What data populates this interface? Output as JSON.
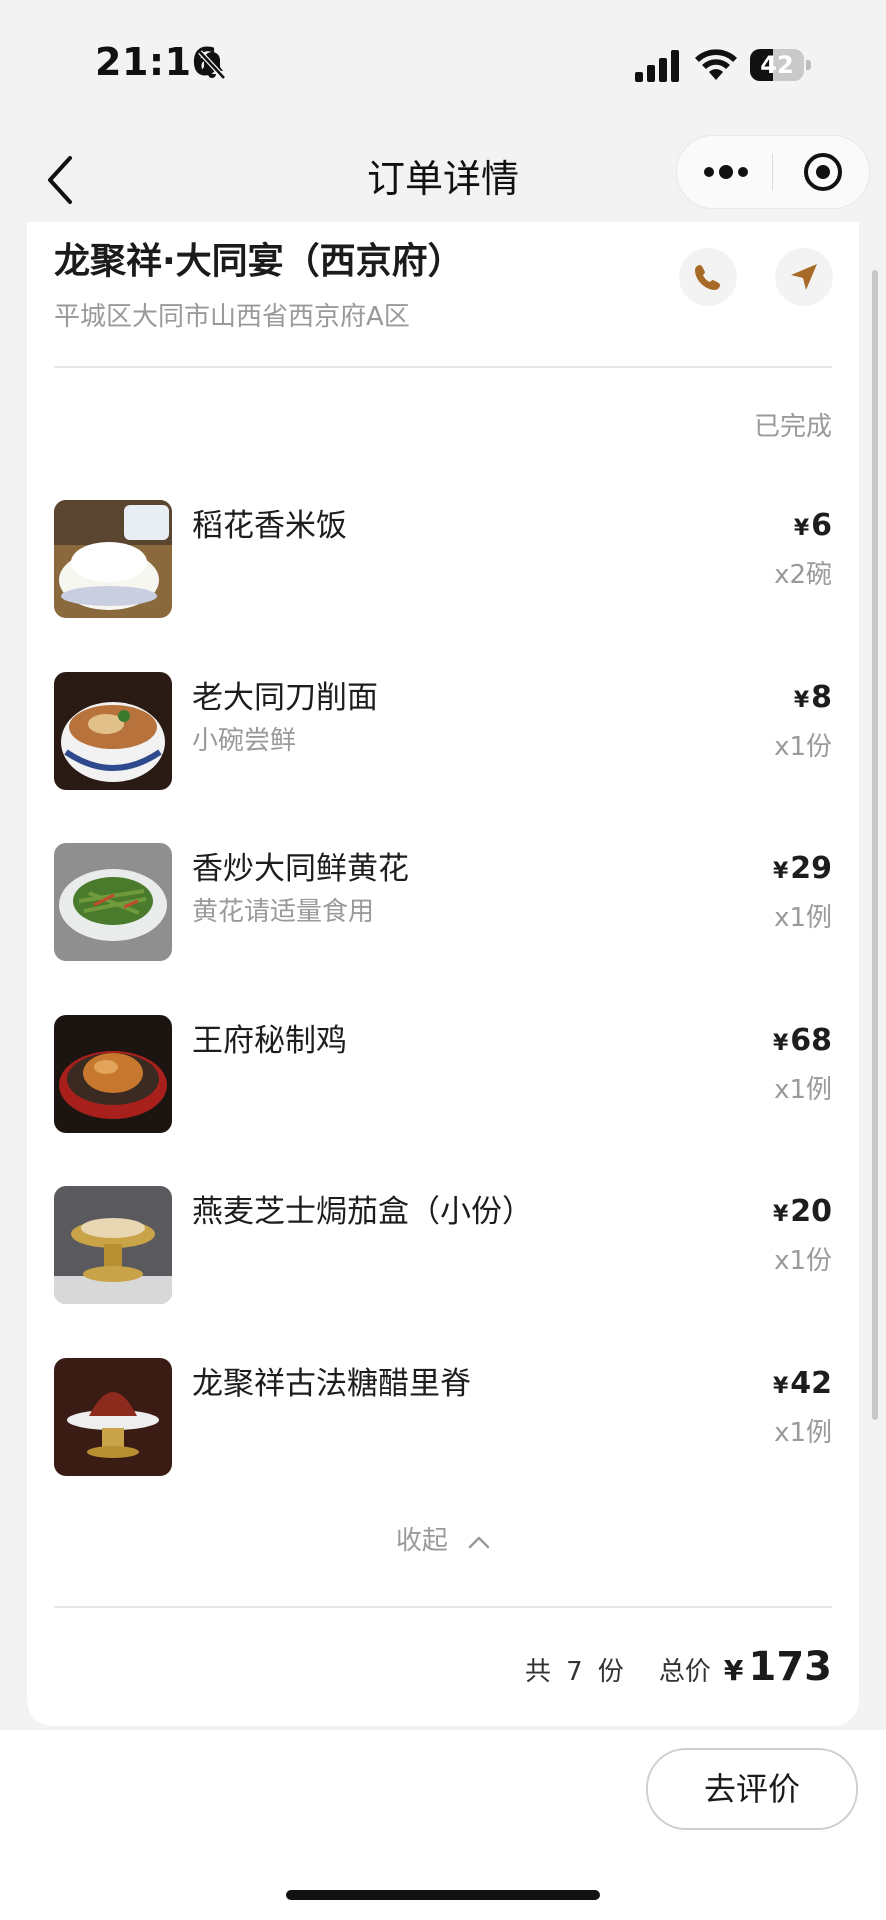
{
  "status_bar": {
    "time": "21:16",
    "battery": "42",
    "battery_level": 0.42
  },
  "nav": {
    "title": "订单详情"
  },
  "store": {
    "name": "龙聚祥·大同宴（西京府）",
    "address": "平城区大同市山西省西京府A区"
  },
  "order": {
    "status": "已完成",
    "items": [
      {
        "name": "稻花香米饭",
        "note": "",
        "currency": "¥",
        "price": "6",
        "qty": "x2碗"
      },
      {
        "name": "老大同刀削面",
        "note": "小碗尝鲜",
        "currency": "¥",
        "price": "8",
        "qty": "x1份"
      },
      {
        "name": "香炒大同鲜黄花",
        "note": "黄花请适量食用",
        "currency": "¥",
        "price": "29",
        "qty": "x1例"
      },
      {
        "name": "王府秘制鸡",
        "note": "",
        "currency": "¥",
        "price": "68",
        "qty": "x1例"
      },
      {
        "name": "燕麦芝士焗茄盒（小份）",
        "note": "",
        "currency": "¥",
        "price": "20",
        "qty": "x1份"
      },
      {
        "name": "龙聚祥古法糖醋里脊",
        "note": "",
        "currency": "¥",
        "price": "42",
        "qty": "x1例"
      }
    ],
    "collapse_label": "收起",
    "summary": {
      "count_prefix": "共",
      "count": "7",
      "count_suffix": "份",
      "total_label": "总价",
      "currency": "¥",
      "total": "173"
    }
  },
  "actions": {
    "review_label": "去评价"
  }
}
